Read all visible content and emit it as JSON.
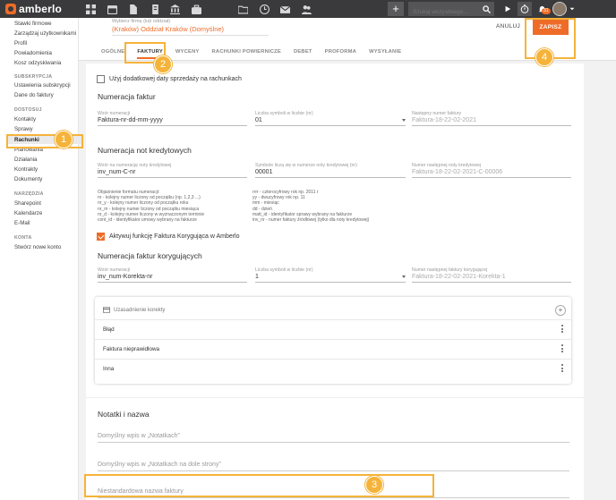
{
  "app": {
    "name": "amberlo"
  },
  "topbar": {
    "search_placeholder": "Szukaj wszystkiego...",
    "notification_count": "31",
    "nav_icons": [
      "dashboard-icon",
      "calendar-icon",
      "document-icon",
      "bank-icon",
      "briefcase-icon",
      "folder-icon",
      "clock-icon",
      "mail-icon",
      "people-icon"
    ]
  },
  "sidebar": {
    "top_items": [
      "Stawki firmowe",
      "Zarządzaj użytkownikami",
      "Profil",
      "Powiadomienia",
      "Kosz odzyskiwania"
    ],
    "sections": [
      {
        "title": "SUBSKRYPCJA",
        "items": [
          "Ustawienia subskrypcji",
          "Dane do faktury"
        ]
      },
      {
        "title": "DOSTOSUJ",
        "items": [
          "Kontakty",
          "Sprawy",
          "Rachunki",
          "Planowania",
          "Działania",
          "Kontrakty",
          "Dokumenty"
        ]
      },
      {
        "title": "NARZĘDZIA",
        "items": [
          "Sharepoint",
          "Kalendarze",
          "E-Mail"
        ]
      },
      {
        "title": "KONTA",
        "items": [
          "Stwórz nowe konto"
        ]
      }
    ],
    "active": "Rachunki"
  },
  "header": {
    "company_label": "Wybierz firmę (lub oddział)",
    "company_value": "(Kraków) Oddział Kraków (Domyślne)",
    "cancel_label": "ANULUJ",
    "save_label": "ZAPISZ",
    "tabs": [
      "OGÓLNE",
      "FAKTURY",
      "WYCENY",
      "RACHUNKI POWIERNICZE",
      "DEBET",
      "PROFORMA",
      "WYSYŁANIE"
    ],
    "active_tab": "FAKTURY"
  },
  "invoices": {
    "extra_date_label": "Użyj dodatkowej daty sprzedaży na rachunkach",
    "numbering_title": "Numeracja faktur",
    "pattern_label": "Wzór numeracji",
    "pattern_value": "Faktura-nr-dd-mm-yyyy",
    "digits_label": "Liczba symboli w liczbie (nr)",
    "digits_value": "01",
    "next_label": "Następny numer faktury",
    "next_value": "Faktura-18-22-02-2021"
  },
  "credit_notes": {
    "title": "Numeracja not kredytowych",
    "pattern_label": "Wzór na numerację noty kredytowej",
    "pattern_value": "inv_num-C-nr",
    "digits_label": "Symbole liczą się w numerze noty kredytowej (nr)",
    "digits_value": "00001",
    "next_label": "Numer następnej noty kredytowej",
    "next_value": "Faktura-18-22-02-2021-C-00006",
    "legend_left": "Objaśnienie formatu numeracji:\nnr - kolejny numer liczony od początku (np. 1,2,3 ...)\nnr_y - kolejny numer liczony od początku roku\nnr_m - kolejny numer liczony od początku miesiąca\nnr_d - kolejny numer liczony w wyznaczonym terminie\ncont_id - identyfikator umowy wybrany na fakturze",
    "legend_right": "rrrr - czterocyfrowy rok np. 2011 r\nyy - dwucyfrowy rok np. 11\nmm - miesiąc\ndd - dzień\nmatt_id - identyfikator sprawy wybrany na fakturze\ninv_nr - numer faktury źródłowej (tylko dla noty kredytowej)",
    "activate_label": "Aktywuj funkcję Faktura Korygująca w Amberlo"
  },
  "corrections": {
    "title": "Numeracja faktur korygujących",
    "pattern_label": "Wzór numeracji",
    "pattern_value": "inv_num-Korekta-nr",
    "digits_label": "Liczba symboli w liczbie (nr)",
    "digits_value": "1",
    "next_label": "Numer następnej faktury korygującej",
    "next_value": "Faktura-18-22-02-2021-Korekta-1",
    "reasons_title": "Uzasadnienie korekty",
    "reasons": [
      "Błąd",
      "Faktura nieprawidłowa",
      "Inna"
    ]
  },
  "notes": {
    "title": "Notatki i nazwa",
    "default_notes_placeholder": "Domyślny wpis w „Notatkach”",
    "default_footer_placeholder": "Domyślny wpis w „Notatkach na dole strony”",
    "custom_name_placeholder": "Niestandardowa nazwa faktury"
  },
  "callouts": [
    "1",
    "2",
    "3",
    "4"
  ],
  "colors": {
    "accent": "#ef6c28",
    "callout": "#f5b33a",
    "topbar": "#3a3a3c"
  }
}
